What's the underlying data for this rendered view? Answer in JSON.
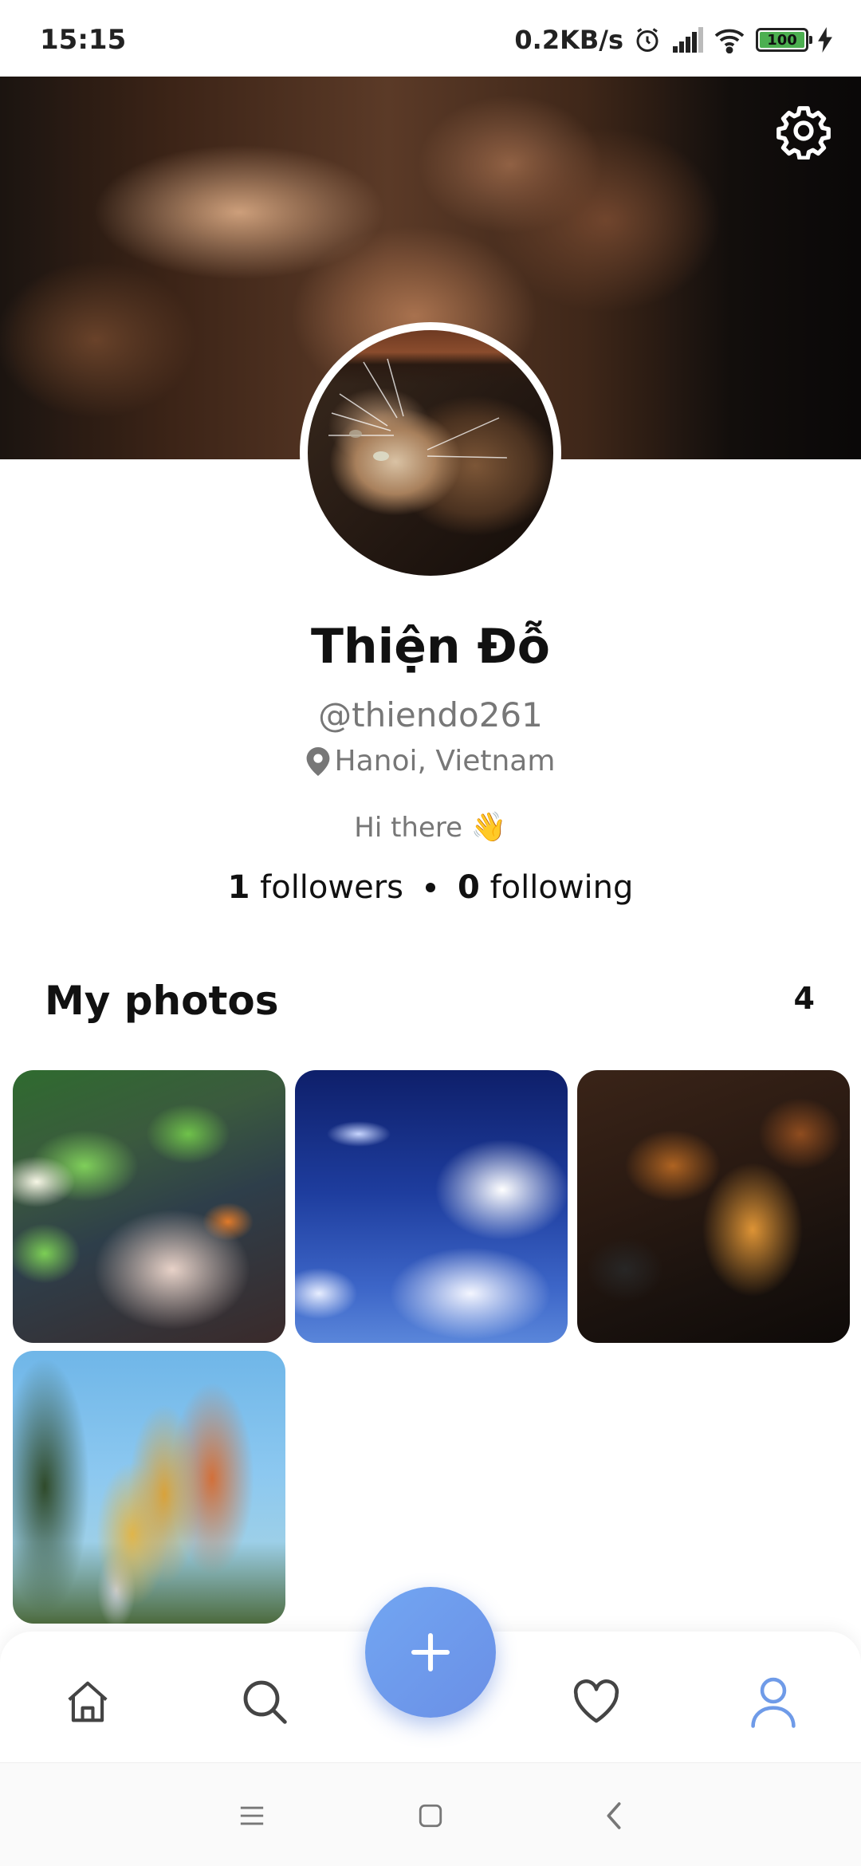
{
  "status_bar": {
    "time": "15:15",
    "net_speed": "0.2KB/s",
    "battery": "100",
    "icons": [
      "alarm-icon",
      "signal-icon",
      "wifi-icon",
      "battery-icon",
      "charging-icon"
    ]
  },
  "header": {
    "settings_icon": "gear-icon"
  },
  "profile": {
    "name": "Thiện Đỗ",
    "handle": "@thiendo261",
    "location": "Hanoi, Vietnam",
    "bio": "Hi there",
    "bio_emoji": "👋",
    "followers_count": "1",
    "followers_label": "followers",
    "following_count": "0",
    "following_label": "following"
  },
  "photos_section": {
    "title": "My photos",
    "count": "4",
    "photos": [
      "photo-1",
      "photo-2",
      "photo-3",
      "photo-4"
    ]
  },
  "bottom_nav": {
    "items": [
      "home-icon",
      "search-icon",
      "add-icon",
      "heart-icon",
      "profile-icon"
    ],
    "active_item": "profile-icon",
    "accent_color": "#6f9be8"
  },
  "system_nav": {
    "items": [
      "menu-icon",
      "home-square-icon",
      "back-icon"
    ]
  }
}
